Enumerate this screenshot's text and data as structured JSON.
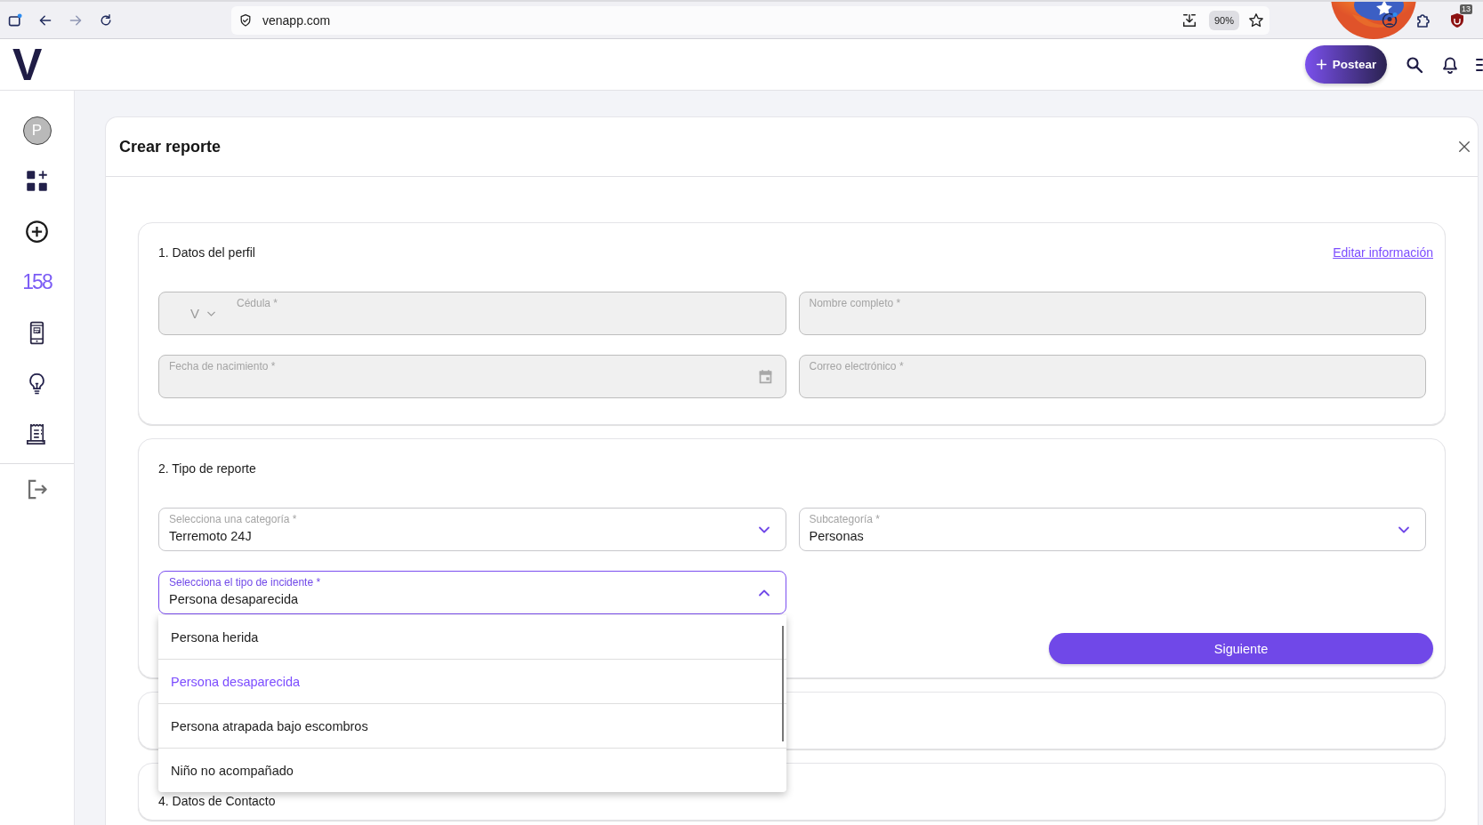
{
  "browser": {
    "url": "venapp.com",
    "zoom": "90%",
    "forward_disabled": true,
    "extension_badge": "13"
  },
  "header": {
    "logo": "V",
    "post_button": "Postear"
  },
  "sidebar": {
    "avatar": "P",
    "items": [
      {
        "selected": false
      },
      {
        "selected": false
      },
      {
        "label": "158",
        "selected": true
      },
      {
        "selected": false
      },
      {
        "selected": false
      },
      {
        "selected": false
      }
    ]
  },
  "modal": {
    "title": "Crear reporte",
    "sections": [
      {
        "title": "1. Datos del perfil",
        "link": "Editar información",
        "expanded": true,
        "fields": [
          {
            "kind": "id",
            "prefix": "V",
            "label": "Cédula *",
            "disabled": true
          },
          {
            "kind": "text",
            "label": "Nombre completo *",
            "disabled": true
          },
          {
            "kind": "date",
            "label": "Fecha de nacimiento *",
            "disabled": true
          },
          {
            "kind": "text",
            "label": "Correo electrónico *",
            "disabled": true
          }
        ]
      },
      {
        "title": "2. Tipo de reporte",
        "expanded": true,
        "fields": [
          {
            "kind": "select",
            "label": "Selecciona una categoría *",
            "value": "Terremoto 24J",
            "expanded": false
          },
          {
            "kind": "select",
            "label": "Subcategoría *",
            "value": "Personas",
            "expanded": false
          },
          {
            "kind": "select",
            "label": "Selecciona el tipo de incidente *",
            "value": "Persona desaparecida",
            "expanded": true,
            "options": [
              {
                "label": "Persona herida",
                "selected": false
              },
              {
                "label": "Persona desaparecida",
                "selected": true
              },
              {
                "label": "Persona atrapada bajo escombros",
                "selected": false
              },
              {
                "label": "Niño no acompañado",
                "selected": false
              }
            ]
          }
        ],
        "button": "Siguiente"
      },
      {
        "expanded": false
      },
      {
        "title": "4. Datos de Contacto",
        "expanded": false
      }
    ]
  }
}
